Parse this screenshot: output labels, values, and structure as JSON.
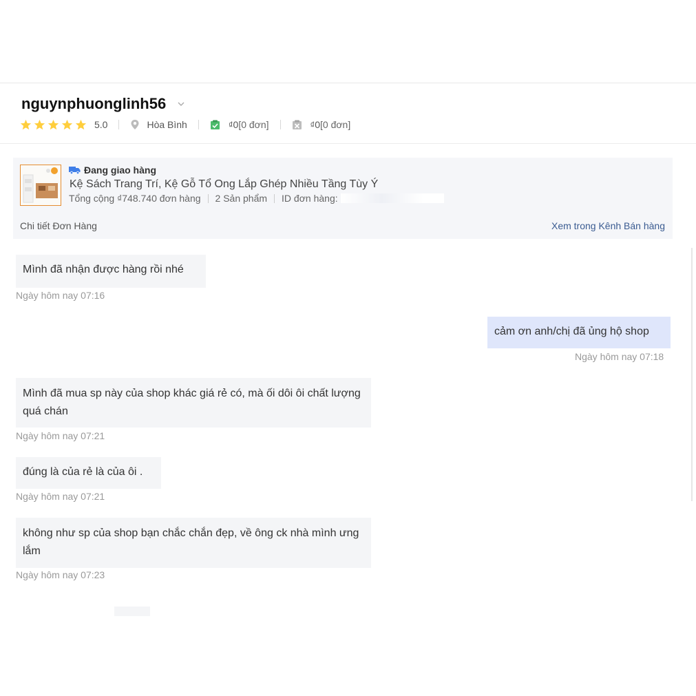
{
  "buyer": {
    "username": "nguynphuonglinh56",
    "rating": "5.0",
    "star_color": "#ffce3d",
    "location": "Hòa Bình",
    "completed_amount": "0",
    "completed_orders": "[0 đơn]",
    "cancelled_amount": "0",
    "cancelled_orders": "[0 đơn]",
    "currency": "₫"
  },
  "order": {
    "status": "Đang giao hàng",
    "product_name": "Kệ Sách Trang Trí, Kệ Gỗ Tổ Ong Lắp Ghép Nhiều Tầng Tùy Ý",
    "total_label": "Tổng cộng",
    "total": "₫748.740",
    "total_suffix": "đơn hàng",
    "item_count": "2 Sản phẩm",
    "order_id_label": "ID đơn hàng:",
    "detail_link": "Chi tiết Đơn Hàng",
    "view_link": "Xem trong Kênh Bán hàng",
    "accent_color": "#3a5b91"
  },
  "messages": [
    {
      "sender": "buyer",
      "text": "Mình đã nhận được hàng rồi nhé",
      "time": "Ngày hôm nay 07:16"
    },
    {
      "sender": "shop",
      "text": "cảm ơn anh/chị đã ủng hộ shop",
      "time": "Ngày hôm nay 07:18"
    },
    {
      "sender": "buyer",
      "text": "Mình đã mua sp này của shop khác giá rẻ có, mà ối dôi ôi chất lượng quá chán",
      "time": "Ngày hôm nay 07:21"
    },
    {
      "sender": "buyer",
      "text": "đúng là của rẻ là của ôi .",
      "time": "Ngày hôm nay 07:21"
    },
    {
      "sender": "buyer",
      "text": "không như sp của shop bạn chắc chắn đẹp, về ông ck nhà mình ưng lắm",
      "time": "Ngày hôm nay 07:23"
    }
  ]
}
